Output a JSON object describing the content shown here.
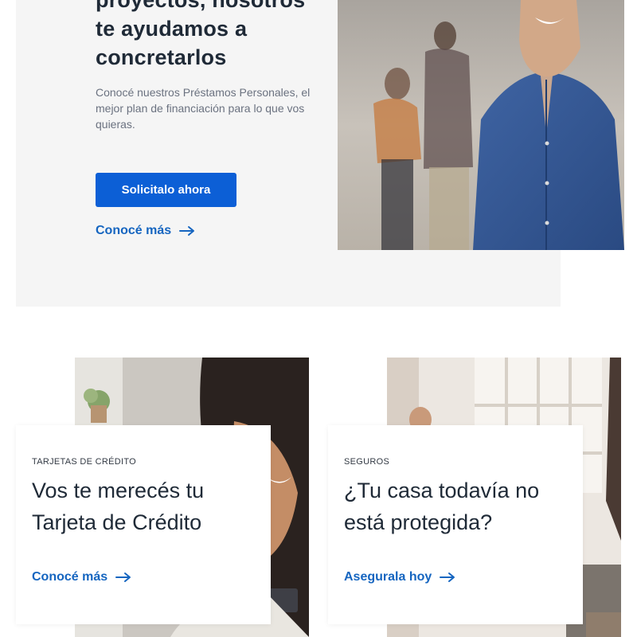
{
  "hero": {
    "title_lines": [
      "proyectos, nosotros",
      "te ayudamos a",
      "concretarlos"
    ],
    "description": "Conocé nuestros Préstamos Personales, el mejor plan de financiación para lo que vos quieras.",
    "cta_label": "Solicitalo ahora",
    "link_label": "Conocé más",
    "link_icon": "arrow-right-icon",
    "photo_icon": "man-smiling-photo"
  },
  "cards": [
    {
      "kicker": "TARJETAS DE CRÉDITO",
      "title": "Vos te merecés tu Tarjeta de Crédito",
      "link_label": "Conocé más",
      "link_icon": "arrow-right-icon",
      "photo_icon": "woman-with-phone-photo"
    },
    {
      "kicker": "SEGUROS",
      "title": "¿Tu casa todavía no está protegida?",
      "link_label": "Asegurala hoy",
      "link_icon": "arrow-right-icon",
      "photo_icon": "home-interior-photo"
    }
  ],
  "colors": {
    "primary": "#0c5fd6",
    "link": "#1565c0",
    "panel_bg": "#f5f5f5",
    "text_dark": "#1f2a37",
    "text_muted": "#6b7280"
  }
}
